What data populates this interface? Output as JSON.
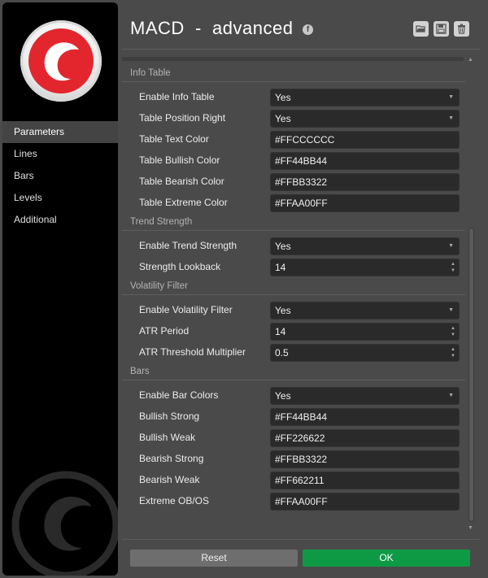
{
  "header": {
    "title": "MACD  -  advanced",
    "facebook_glyph": "f",
    "icons": [
      "folder-open-icon",
      "save-icon",
      "trash-icon"
    ]
  },
  "sidebar": {
    "items": [
      {
        "label": "Parameters",
        "active": true
      },
      {
        "label": "Lines",
        "active": false
      },
      {
        "label": "Bars",
        "active": false
      },
      {
        "label": "Levels",
        "active": false
      },
      {
        "label": "Additional",
        "active": false
      }
    ]
  },
  "sections": {
    "info_table": {
      "title": "Info Table",
      "rows": [
        {
          "label": "Enable Info Table",
          "value": "Yes"
        },
        {
          "label": "Table Position Right",
          "value": "Yes"
        },
        {
          "label": "Table Text Color",
          "value": "#FFCCCCCC"
        },
        {
          "label": "Table Bullish Color",
          "value": "#FF44BB44"
        },
        {
          "label": "Table Bearish Color",
          "value": "#FFBB3322"
        },
        {
          "label": "Table Extreme Color",
          "value": "#FFAA00FF"
        }
      ]
    },
    "trend_strength": {
      "title": "Trend Strength",
      "rows": [
        {
          "label": "Enable Trend Strength",
          "value": "Yes"
        },
        {
          "label": "Strength Lookback",
          "value": "14"
        }
      ]
    },
    "volatility_filter": {
      "title": "Volatility Filter",
      "rows": [
        {
          "label": "Enable Volatility Filter",
          "value": "Yes"
        },
        {
          "label": "ATR Period",
          "value": "14"
        },
        {
          "label": "ATR Threshold Multiplier",
          "value": "0.5"
        }
      ]
    },
    "bars": {
      "title": "Bars",
      "rows": [
        {
          "label": "Enable Bar Colors",
          "value": "Yes"
        },
        {
          "label": "Bullish Strong",
          "value": "#FF44BB44"
        },
        {
          "label": "Bullish Weak",
          "value": "#FF226622"
        },
        {
          "label": "Bearish Strong",
          "value": "#FFBB3322"
        },
        {
          "label": "Bearish Weak",
          "value": "#FF662211"
        },
        {
          "label": "Extreme OB/OS",
          "value": "#FFAA00FF"
        }
      ]
    }
  },
  "buttons": {
    "reset": "Reset",
    "ok": "OK"
  },
  "colors": {
    "ok_button": "#0e9a45",
    "logo_red": "#e3262e"
  }
}
